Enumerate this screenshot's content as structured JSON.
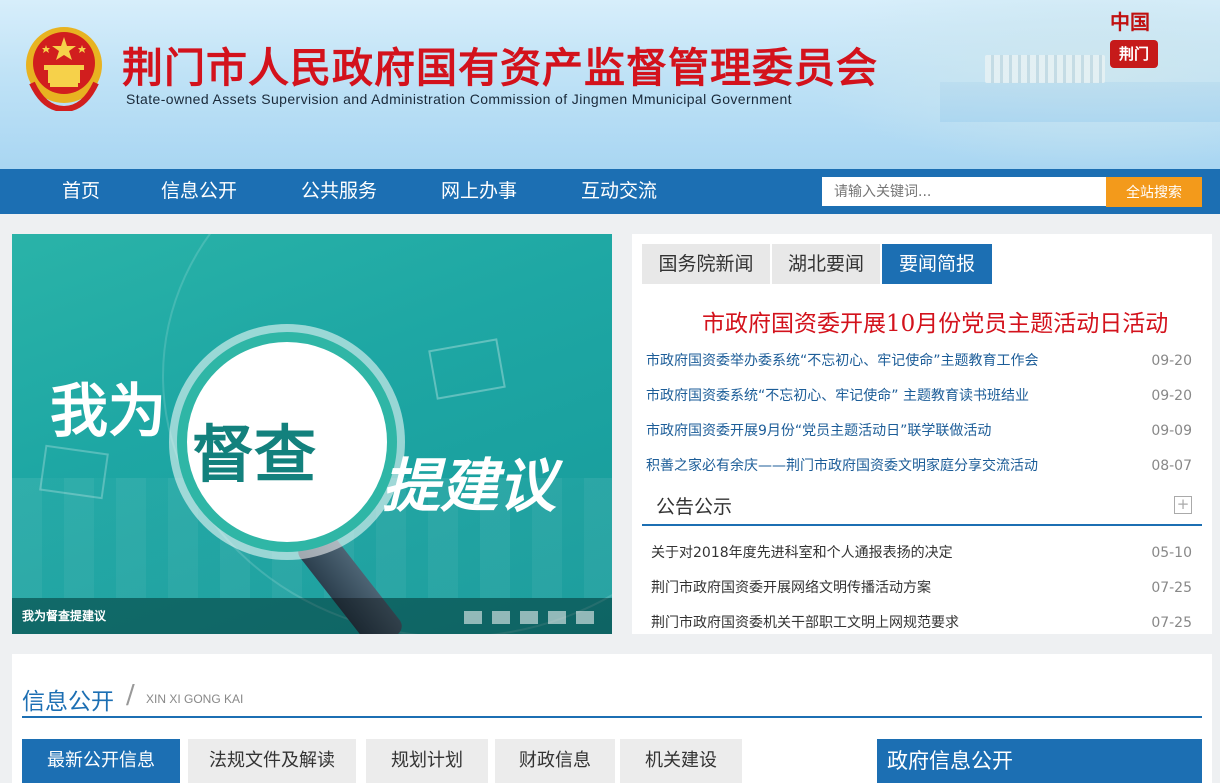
{
  "header": {
    "title_cn": "荆门市人民政府国有资产监督管理委员会",
    "title_en": "State-owned Assets Supervision and Administration Commission of Jingmen Mmunicipal Government",
    "city_logo": {
      "top": "中国",
      "bottom": "荆门"
    },
    "emblem_icon": "national-emblem-icon"
  },
  "nav": {
    "items": [
      "首页",
      "信息公开",
      "公共服务",
      "网上办事",
      "互动交流"
    ],
    "search_placeholder": "请输入关键词...",
    "search_button": "全站搜索"
  },
  "slider": {
    "text_left": "我为",
    "text_center": "督查",
    "text_right": "提建议",
    "caption": "我为督查提建议",
    "dot_count": 5
  },
  "news": {
    "tabs": [
      "国务院新闻",
      "湖北要闻",
      "要闻简报"
    ],
    "active_tab": "要闻简报",
    "headline": "市政府国资委开展10月份党员主题活动日活动",
    "items": [
      {
        "title": "市政府国资委举办委系统“不忘初心、牢记使命”主题教育工作会",
        "date": "09-20"
      },
      {
        "title": "市政府国资委系统“不忘初心、牢记使命” 主题教育读书班结业",
        "date": "09-20"
      },
      {
        "title": "市政府国资委开展9月份“党员主题活动日”联学联做活动",
        "date": "09-09"
      },
      {
        "title": "积善之家必有余庆——荆门市政府国资委文明家庭分享交流活动",
        "date": "08-07"
      }
    ]
  },
  "notice": {
    "title": "公告公示",
    "more": "+",
    "items": [
      {
        "title": "关于对2018年度先进科室和个人通报表扬的决定",
        "date": "05-10"
      },
      {
        "title": "荆门市政府国资委开展网络文明传播活动方案",
        "date": "07-25"
      },
      {
        "title": "荆门市政府国资委机关干部职工文明上网规范要求",
        "date": "07-25"
      }
    ]
  },
  "info": {
    "title": "信息公开",
    "slash": "/",
    "subtitle": "XIN XI GONG KAI",
    "tabs": [
      "最新公开信息",
      "法规文件及解读",
      "规划计划",
      "财政信息",
      "机关建设"
    ],
    "active_tab": "最新公开信息",
    "gov_open": "政府信息公开"
  },
  "colors": {
    "primary_blue": "#1c6fb3",
    "title_red": "#d3121c",
    "search_orange": "#f39a1b",
    "slider_teal": "#1ea7a4"
  }
}
